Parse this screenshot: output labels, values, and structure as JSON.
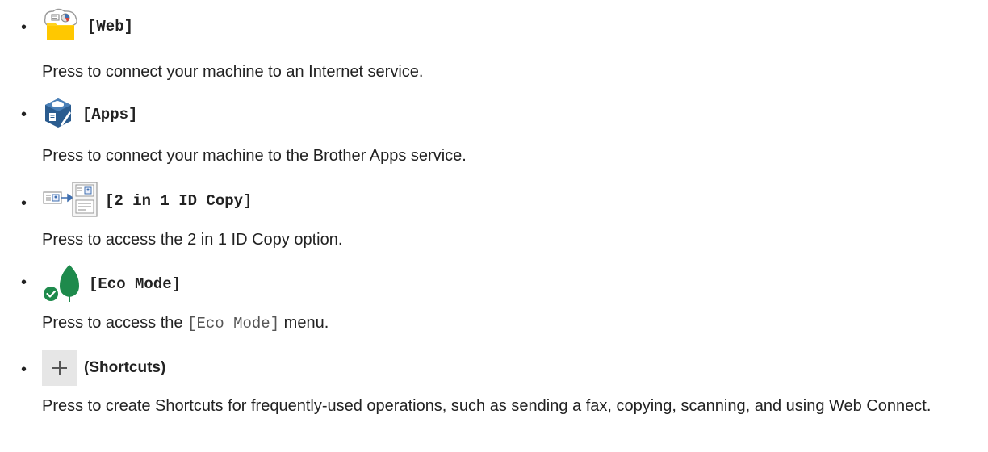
{
  "items": [
    {
      "label": "[Web]",
      "icon": "web-icon",
      "description": "Press to connect your machine to an Internet service."
    },
    {
      "label": "[Apps]",
      "icon": "apps-icon",
      "description": "Press to connect your machine to the Brother Apps service."
    },
    {
      "label": "[2 in 1 ID Copy]",
      "icon": "id-copy-icon",
      "description": "Press to access the 2 in 1 ID Copy option."
    },
    {
      "label": "[Eco Mode]",
      "icon": "eco-mode-icon",
      "description_prefix": "Press to access the ",
      "description_code": "[Eco Mode]",
      "description_suffix": " menu."
    },
    {
      "label": "(Shortcuts)",
      "icon": "plus-icon",
      "description": "Press to create Shortcuts for frequently-used operations, such as sending a fax, copying, scanning, and using Web Connect."
    }
  ],
  "bullet": "•",
  "colors": {
    "text": "#222222",
    "folder_yellow": "#FFD21E",
    "apps_blue": "#2B5C8F",
    "eco_green": "#1E8A4C",
    "shortcut_bg": "#E6E6E6"
  }
}
